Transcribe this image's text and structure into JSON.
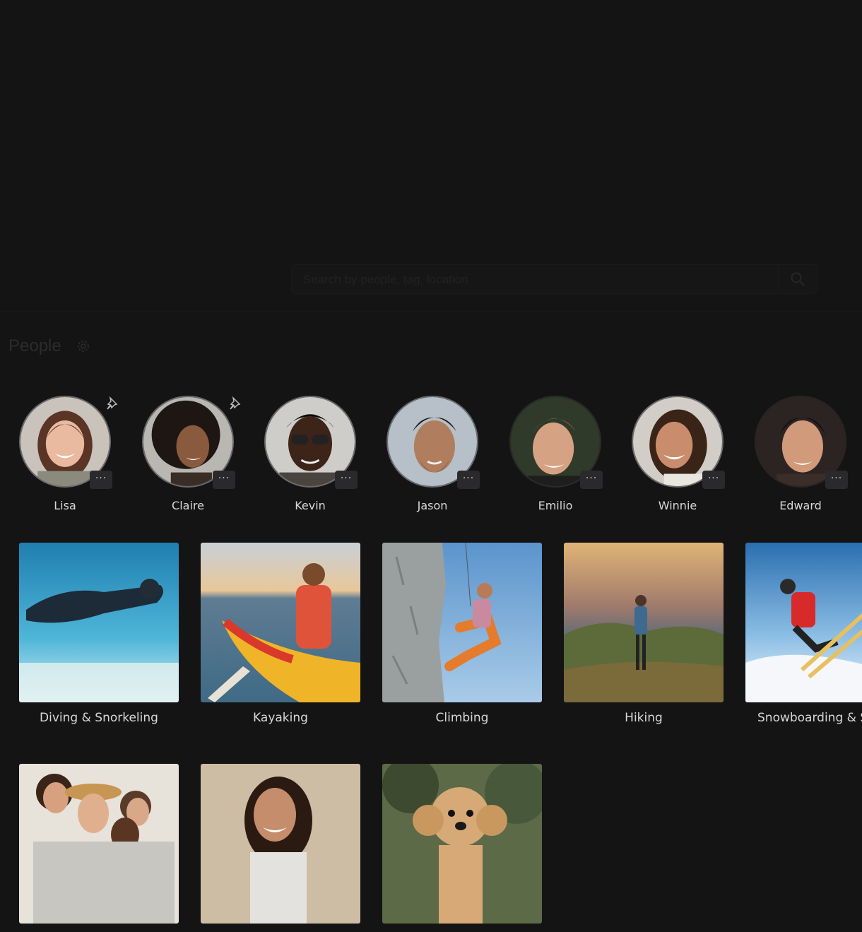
{
  "search": {
    "placeholder": "Search by people, tag, location"
  },
  "people_section": {
    "title": "People",
    "more_label": "···",
    "persons": [
      {
        "name": "Lisa",
        "pinned": true
      },
      {
        "name": "Claire",
        "pinned": true
      },
      {
        "name": "Kevin",
        "pinned": false
      },
      {
        "name": "Jason",
        "pinned": false
      },
      {
        "name": "Emilio",
        "pinned": false
      },
      {
        "name": "Winnie",
        "pinned": false
      },
      {
        "name": "Edward",
        "pinned": false
      }
    ]
  },
  "categories": [
    {
      "label": "Diving & Snorkeling"
    },
    {
      "label": "Kayaking"
    },
    {
      "label": "Climbing"
    },
    {
      "label": "Hiking"
    },
    {
      "label": "Snowboarding & Skiing"
    },
    {
      "label": ""
    },
    {
      "label": ""
    },
    {
      "label": ""
    }
  ],
  "colors": {
    "background": "#141415",
    "avatar_ring": "#6a6a6e",
    "more_button": "#2a2a2c"
  },
  "icons": [
    "search-icon",
    "gear-icon",
    "pin-icon",
    "more-icon"
  ]
}
